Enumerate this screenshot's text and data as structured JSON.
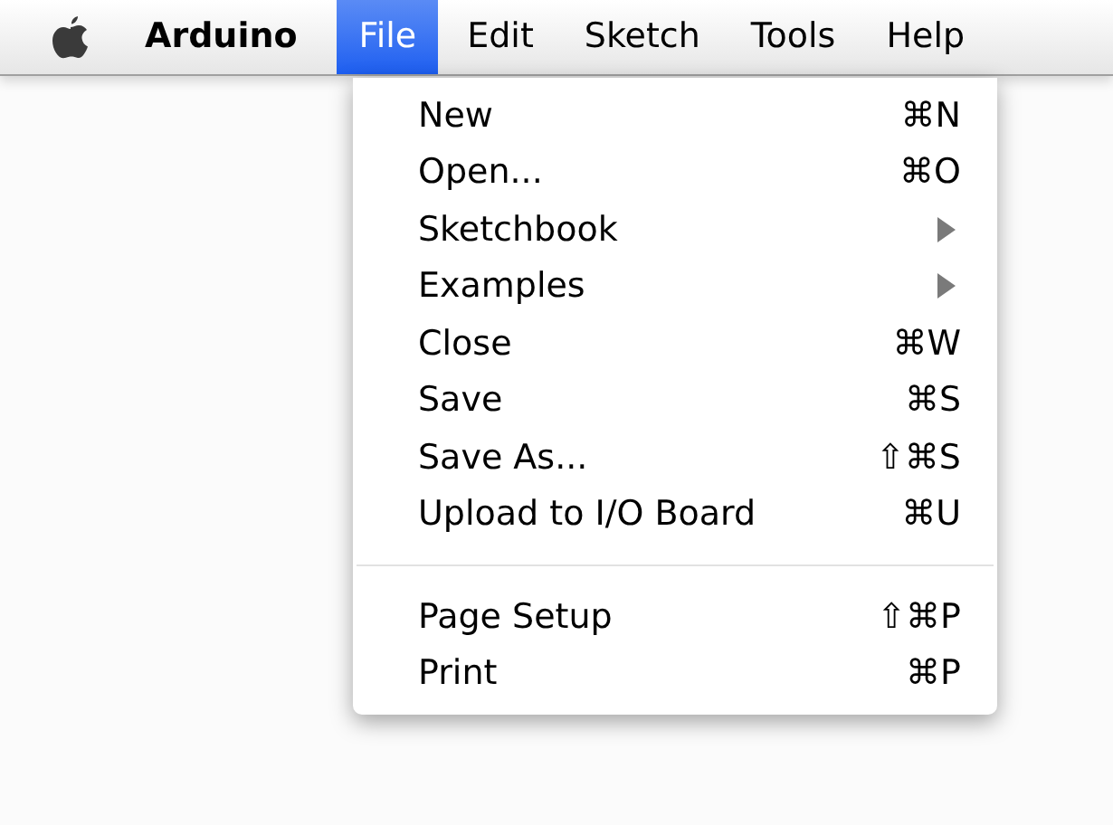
{
  "menu_bar": {
    "app_name": "Arduino",
    "menus": [
      {
        "label": "File",
        "selected": true
      },
      {
        "label": "Edit",
        "selected": false
      },
      {
        "label": "Sketch",
        "selected": false
      },
      {
        "label": "Tools",
        "selected": false
      },
      {
        "label": "Help",
        "selected": false
      }
    ]
  },
  "file_menu": {
    "items": [
      {
        "kind": "command",
        "label": "New",
        "shortcut": "⌘N"
      },
      {
        "kind": "command",
        "label": "Open...",
        "shortcut": "⌘O"
      },
      {
        "kind": "submenu",
        "label": "Sketchbook"
      },
      {
        "kind": "submenu",
        "label": "Examples"
      },
      {
        "kind": "command",
        "label": "Close",
        "shortcut": "⌘W"
      },
      {
        "kind": "command",
        "label": "Save",
        "shortcut": "⌘S"
      },
      {
        "kind": "command",
        "label": "Save As...",
        "shortcut": "⇧⌘S"
      },
      {
        "kind": "command",
        "label": "Upload to I/O Board",
        "shortcut": "⌘U"
      },
      {
        "kind": "separator"
      },
      {
        "kind": "command",
        "label": "Page Setup",
        "shortcut": "⇧⌘P"
      },
      {
        "kind": "command",
        "label": "Print",
        "shortcut": "⌘P"
      }
    ]
  }
}
